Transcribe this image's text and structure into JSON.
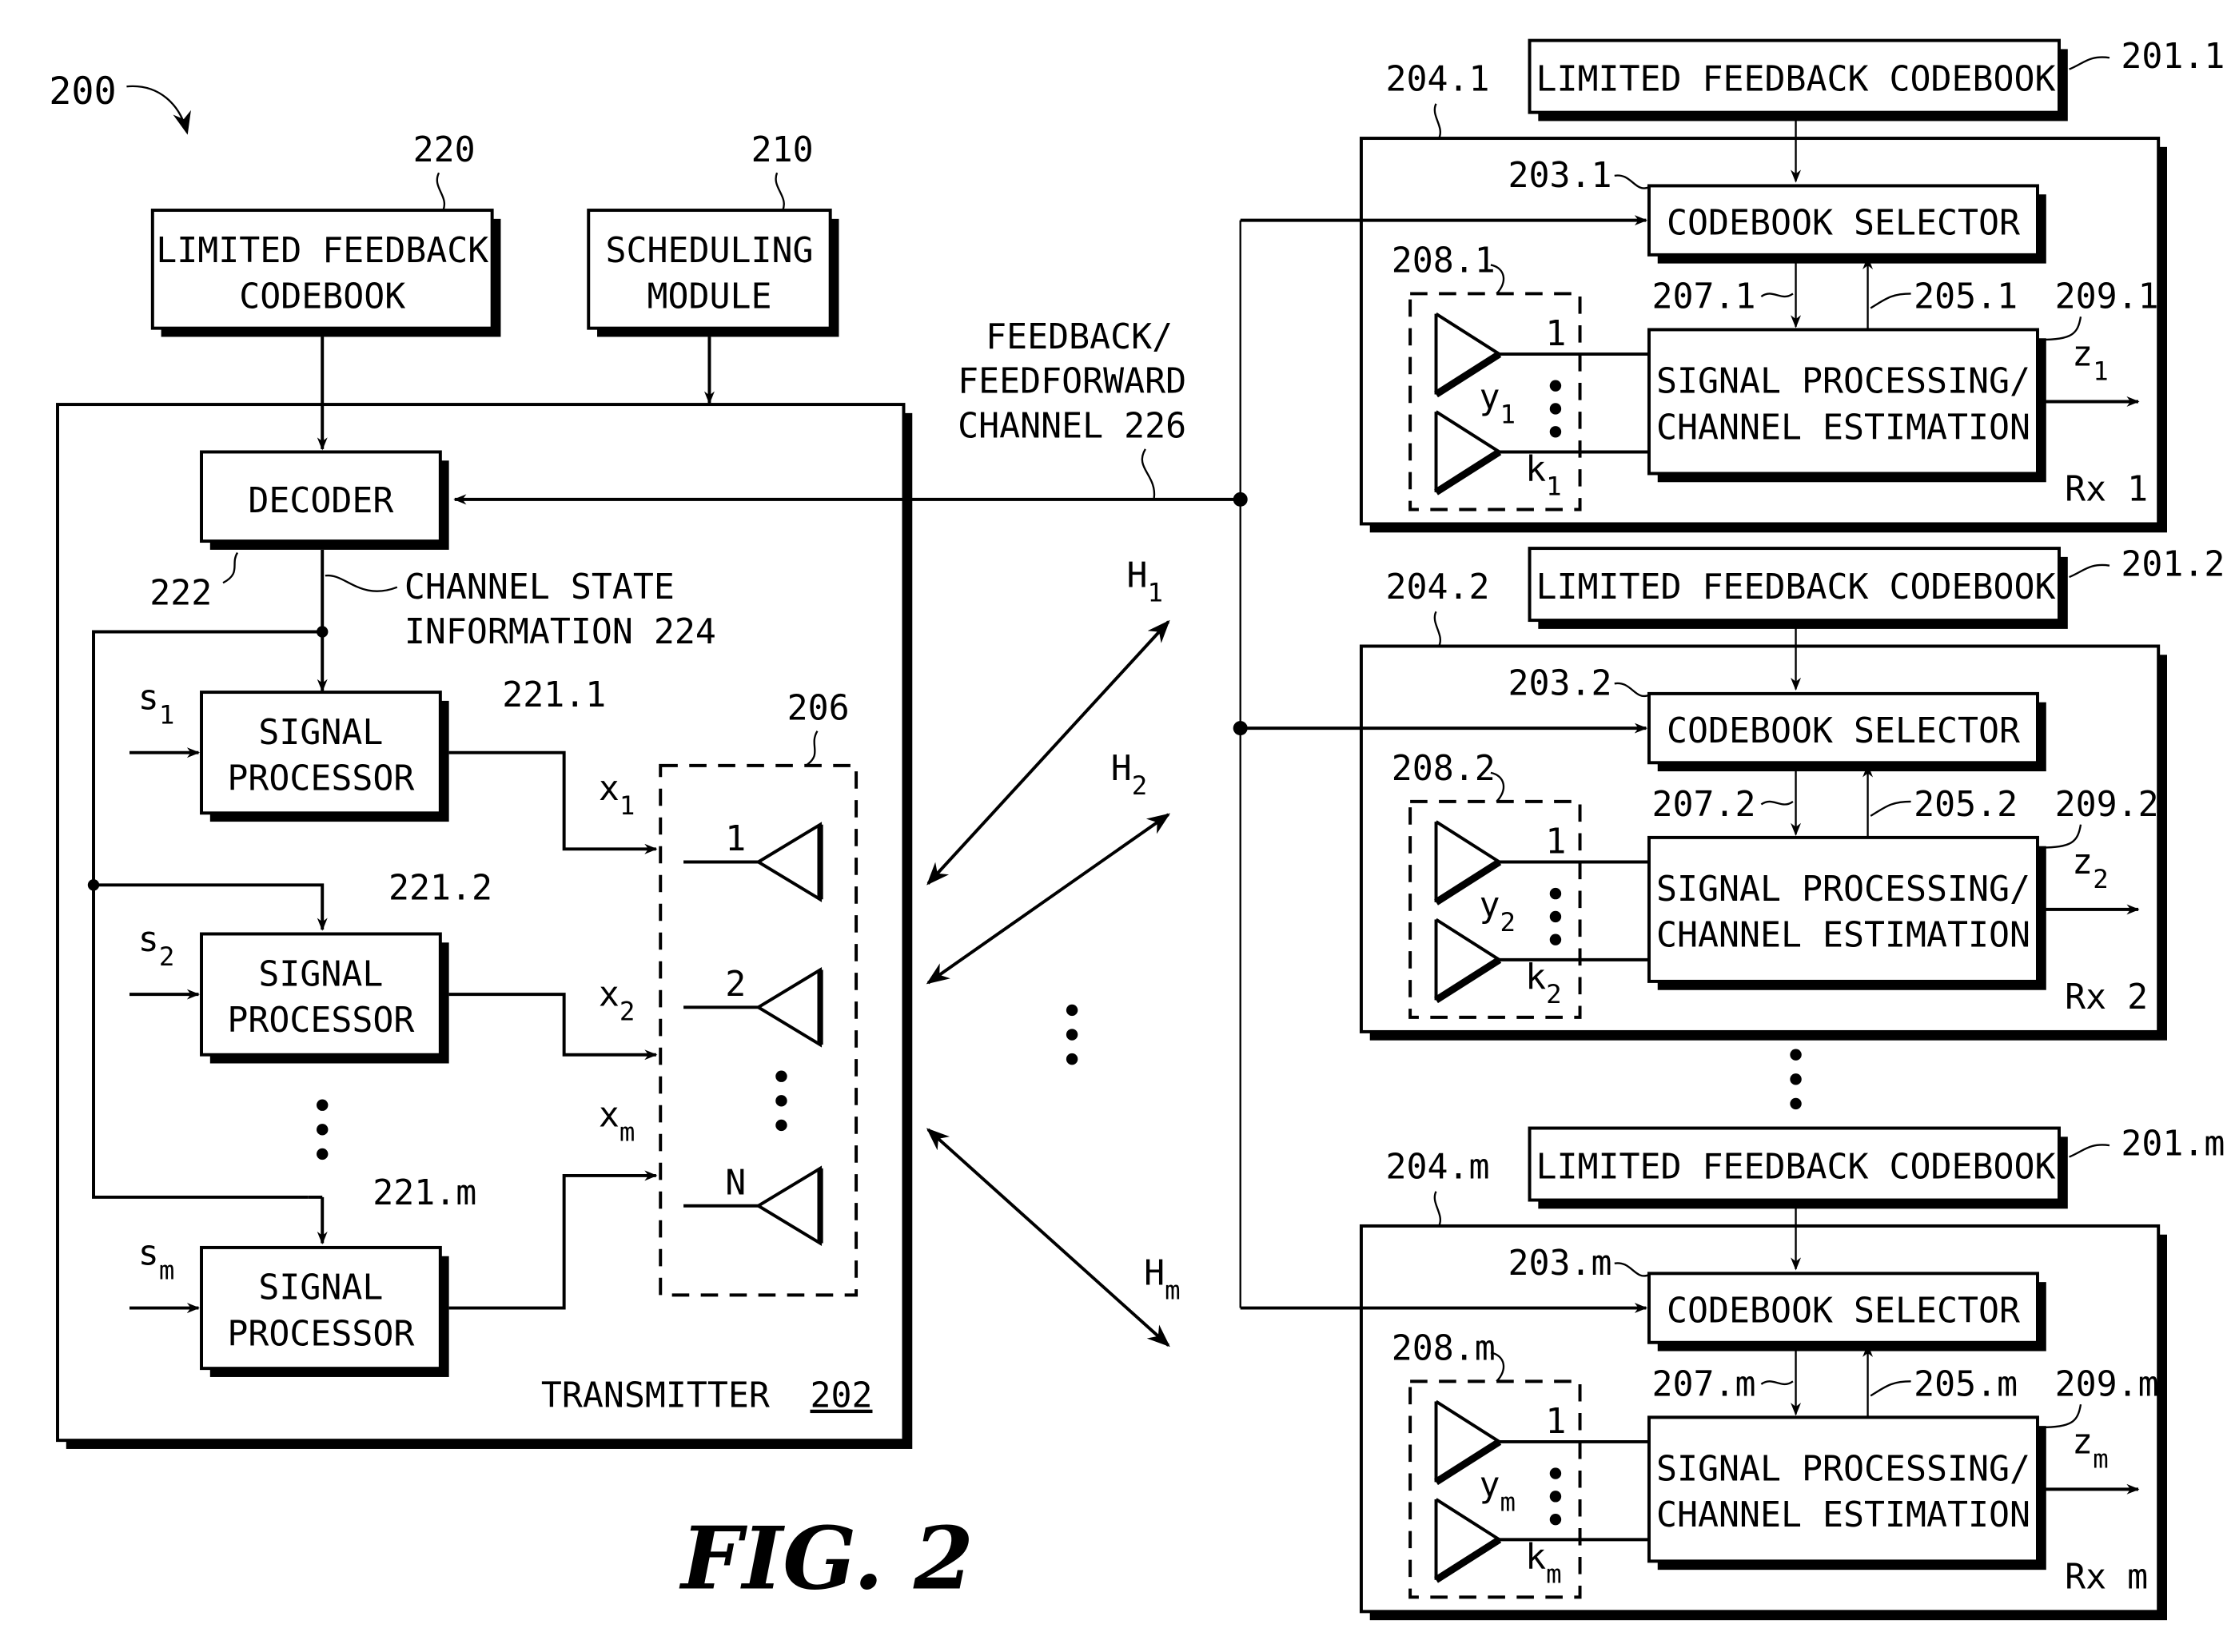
{
  "figure": {
    "ref": "200",
    "caption": "FIG. 2"
  },
  "transmitter": {
    "label": "TRANSMITTER",
    "ref": "202",
    "codebook": {
      "line1": "LIMITED FEEDBACK",
      "line2": "CODEBOOK",
      "ref": "220"
    },
    "scheduler": {
      "line1": "SCHEDULING",
      "line2": "MODULE",
      "ref": "210"
    },
    "decoder": {
      "label": "DECODER",
      "ref": "222"
    },
    "csi": {
      "line1": "CHANNEL STATE",
      "line2": "INFORMATION 224"
    },
    "signal_processors": [
      {
        "line1": "SIGNAL",
        "line2": "PROCESSOR",
        "ref": "221.1",
        "input": "s",
        "input_sub": "1",
        "output": "x",
        "output_sub": "1"
      },
      {
        "line1": "SIGNAL",
        "line2": "PROCESSOR",
        "ref": "221.2",
        "input": "s",
        "input_sub": "2",
        "output": "x",
        "output_sub": "2"
      },
      {
        "line1": "SIGNAL",
        "line2": "PROCESSOR",
        "ref": "221.m",
        "input": "s",
        "input_sub": "m",
        "output": "x",
        "output_sub": "m"
      }
    ],
    "antenna_array": {
      "ref": "206",
      "antennas": [
        "1",
        "2",
        "N"
      ]
    }
  },
  "channel": {
    "line1": "FEEDBACK/",
    "line2": "FEEDFORWARD",
    "line3": "CHANNEL 226",
    "links": [
      {
        "label": "H",
        "sub": "1"
      },
      {
        "label": "H",
        "sub": "2"
      },
      {
        "label": "H",
        "sub": "m"
      }
    ]
  },
  "receivers": [
    {
      "ref": "204.1",
      "name": "Rx 1",
      "codebook": {
        "label": "LIMITED FEEDBACK CODEBOOK",
        "ref": "201.1"
      },
      "selector": {
        "label": "CODEBOOK SELECTOR",
        "ref": "203.1"
      },
      "processing": {
        "line1": "SIGNAL PROCESSING/",
        "line2": "CHANNEL ESTIMATION",
        "ref": "209.1"
      },
      "down_ref": "207.1",
      "up_ref": "205.1",
      "array": {
        "ref": "208.1",
        "first": "1",
        "y": "y",
        "y_sub": "1",
        "k": "k",
        "k_sub": "1"
      },
      "output": {
        "label": "z",
        "sub": "1"
      }
    },
    {
      "ref": "204.2",
      "name": "Rx 2",
      "codebook": {
        "label": "LIMITED FEEDBACK CODEBOOK",
        "ref": "201.2"
      },
      "selector": {
        "label": "CODEBOOK SELECTOR",
        "ref": "203.2"
      },
      "processing": {
        "line1": "SIGNAL PROCESSING/",
        "line2": "CHANNEL ESTIMATION",
        "ref": "209.2"
      },
      "down_ref": "207.2",
      "up_ref": "205.2",
      "array": {
        "ref": "208.2",
        "first": "1",
        "y": "y",
        "y_sub": "2",
        "k": "k",
        "k_sub": "2"
      },
      "output": {
        "label": "z",
        "sub": "2"
      }
    },
    {
      "ref": "204.m",
      "name": "Rx m",
      "codebook": {
        "label": "LIMITED FEEDBACK CODEBOOK",
        "ref": "201.m"
      },
      "selector": {
        "label": "CODEBOOK SELECTOR",
        "ref": "203.m"
      },
      "processing": {
        "line1": "SIGNAL PROCESSING/",
        "line2": "CHANNEL ESTIMATION",
        "ref": "209.m"
      },
      "down_ref": "207.m",
      "up_ref": "205.m",
      "array": {
        "ref": "208.m",
        "first": "1",
        "y": "y",
        "y_sub": "m",
        "k": "k",
        "k_sub": "m"
      },
      "output": {
        "label": "z",
        "sub": "m"
      }
    }
  ]
}
